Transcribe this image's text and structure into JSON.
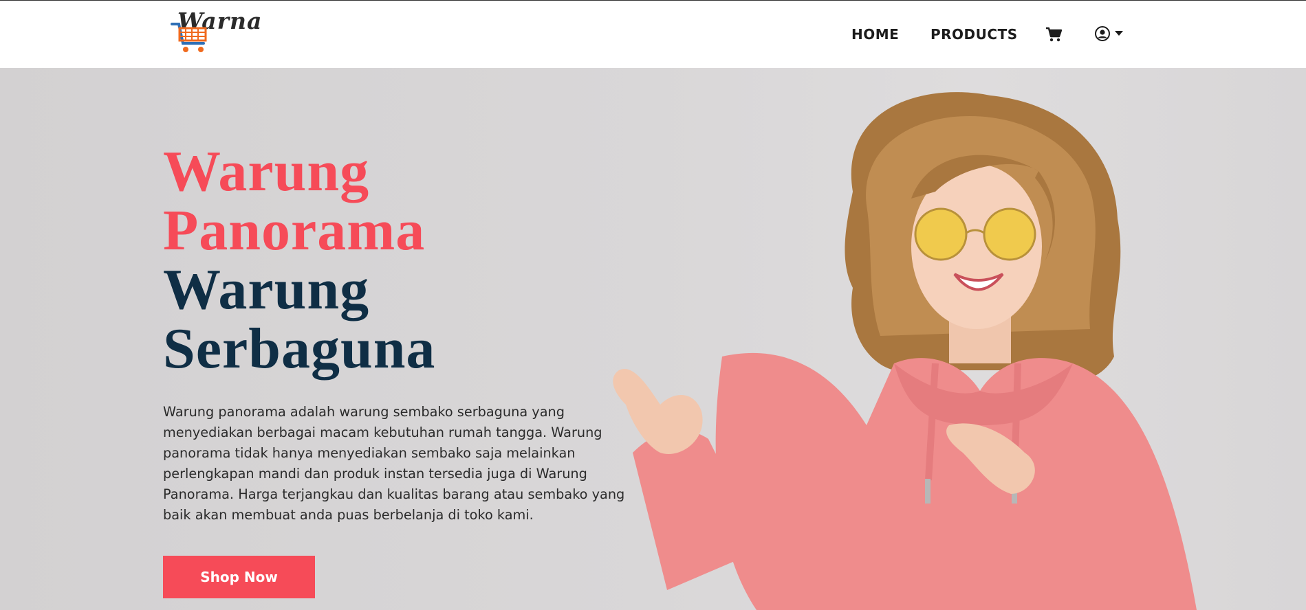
{
  "logo": {
    "text": "Warna",
    "icon": "shopping-cart-logo-icon"
  },
  "nav": {
    "home": "HOME",
    "products": "PRODUCTS",
    "cart_icon": "cart-icon",
    "user_icon": "user-circle-icon"
  },
  "hero": {
    "headline_lines": [
      "Warung",
      "Panorama",
      "Warung",
      "Serbaguna"
    ],
    "description": "Warung panorama adalah warung sembako serbaguna yang menyediakan berbagai macam kebutuhan rumah tangga. Warung panorama tidak hanya menyediakan sembako saja melainkan perlengkapan mandi dan produk instan tersedia juga di Warung Panorama. Harga terjangkau dan kualitas barang atau sembako yang baik akan membuat anda puas berbelanja di toko kami.",
    "cta_label": "Shop Now",
    "image": "woman-pointing-photo"
  },
  "colors": {
    "accent": "#f64b58",
    "navy": "#0f2e45",
    "hero_bg": "#d9d7d8"
  }
}
